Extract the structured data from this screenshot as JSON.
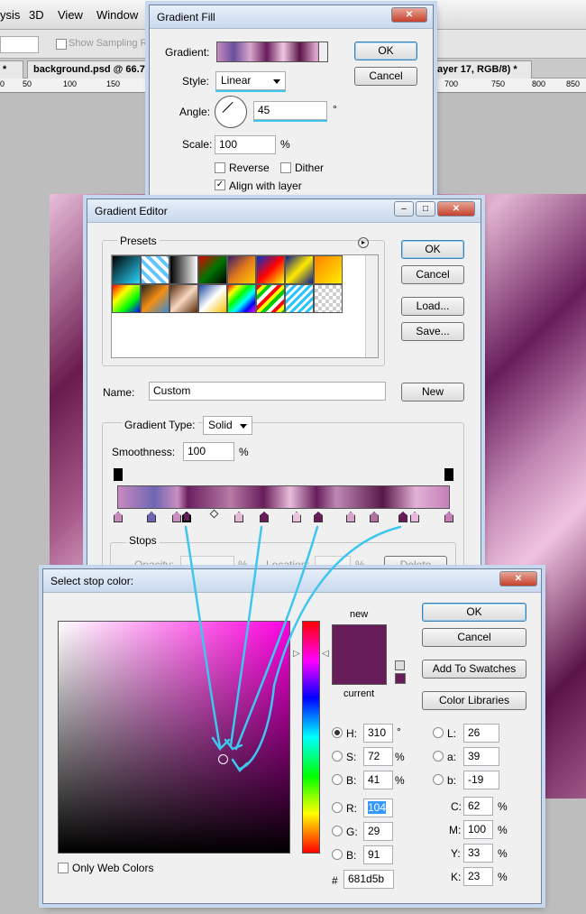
{
  "app": {
    "menu": [
      "ysis",
      "3D",
      "View",
      "Window"
    ],
    "options": {
      "sampling": "Show Sampling Ring"
    },
    "tabs": [
      {
        "label": "background.psd @ 66.7"
      },
      {
        "label": "ayer 17, RGB/8) *"
      }
    ],
    "ruler": [
      "0",
      "50",
      "100",
      "150",
      "700",
      "750",
      "800",
      "850"
    ]
  },
  "gradient_fill": {
    "title": "Gradient Fill",
    "gradient_label": "Gradient:",
    "style_label": "Style:",
    "style_value": "Linear",
    "angle_label": "Angle:",
    "angle_value": "45",
    "angle_unit": "°",
    "scale_label": "Scale:",
    "scale_value": "100",
    "scale_unit": "%",
    "reverse": "Reverse",
    "dither": "Dither",
    "align": "Align with layer",
    "ok": "OK",
    "cancel": "Cancel"
  },
  "gradient_editor": {
    "title": "Gradient Editor",
    "presets_label": "Presets",
    "ok": "OK",
    "cancel": "Cancel",
    "load": "Load...",
    "save": "Save...",
    "name_label": "Name:",
    "name_value": "Custom",
    "new": "New",
    "type_label": "Gradient Type:",
    "type_value": "Solid",
    "smooth_label": "Smoothness:",
    "smooth_value": "100",
    "smooth_unit": "%",
    "stops_label": "Stops",
    "opacity_label": "Opacity:",
    "location_label": "Location:",
    "delete": "Delete",
    "pct": "%"
  },
  "color_picker": {
    "title": "Select stop color:",
    "ok": "OK",
    "cancel": "Cancel",
    "add_swatches": "Add To Swatches",
    "color_libraries": "Color Libraries",
    "new_label": "new",
    "current_label": "current",
    "new_color": "#681d5b",
    "only_web": "Only Web Colors",
    "hsb": [
      {
        "label": "H:",
        "value": "310",
        "unit": "°"
      },
      {
        "label": "S:",
        "value": "72",
        "unit": "%"
      },
      {
        "label": "B:",
        "value": "41",
        "unit": "%"
      }
    ],
    "rgb": [
      {
        "label": "R:",
        "value": "104"
      },
      {
        "label": "G:",
        "value": "29"
      },
      {
        "label": "B:",
        "value": "91"
      }
    ],
    "lab": [
      {
        "label": "L:",
        "value": "26"
      },
      {
        "label": "a:",
        "value": "39"
      },
      {
        "label": "b:",
        "value": "-19"
      }
    ],
    "cmyk": [
      {
        "label": "C:",
        "value": "62",
        "unit": "%"
      },
      {
        "label": "M:",
        "value": "100",
        "unit": "%"
      },
      {
        "label": "Y:",
        "value": "33",
        "unit": "%"
      },
      {
        "label": "K:",
        "value": "23",
        "unit": "%"
      }
    ],
    "hex_label": "#",
    "hex_value": "681d5b"
  },
  "colors": {
    "accent": "#3ec7ee",
    "selected": "#681d5b"
  }
}
